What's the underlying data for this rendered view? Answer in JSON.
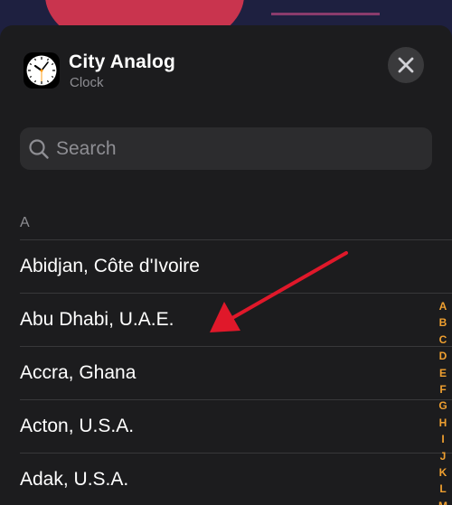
{
  "widget": {
    "title": "City Analog",
    "subtitle": "Clock",
    "icon": "analog-clock-icon"
  },
  "close": {
    "icon": "close-x-icon"
  },
  "search": {
    "placeholder": "Search",
    "value": ""
  },
  "list": {
    "section": "A",
    "cities": [
      "Abidjan, Côte d'Ivoire",
      "Abu Dhabi, U.A.E.",
      "Accra, Ghana",
      "Acton, U.S.A.",
      "Adak, U.S.A."
    ]
  },
  "index": [
    "A",
    "B",
    "C",
    "D",
    "E",
    "F",
    "G",
    "H",
    "I",
    "J",
    "K",
    "L",
    "M"
  ],
  "colors": {
    "sheet_bg": "#1c1c1e",
    "index_accent": "#f0a030",
    "annotation_arrow": "#e0182a"
  }
}
